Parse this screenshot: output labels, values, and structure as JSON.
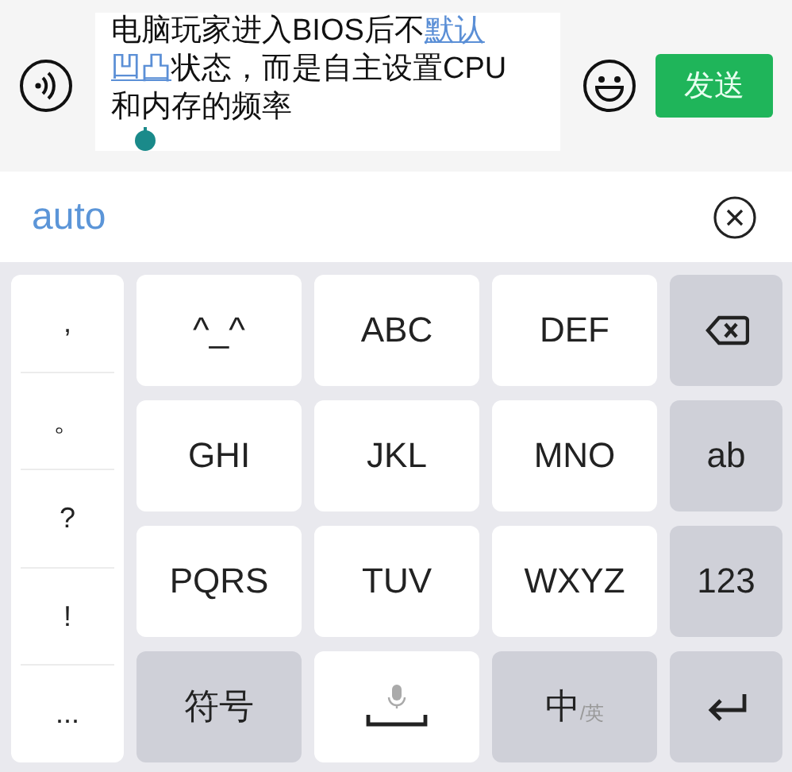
{
  "composer": {
    "message": [
      [
        {
          "text": "电脑玩家进入BIOS后不",
          "selected": false
        },
        {
          "text": "默认",
          "selected": true
        }
      ],
      [
        {
          "text": "凹凸",
          "selected": true
        },
        {
          "text": "状态，而是自主设置CPU",
          "selected": false
        }
      ],
      [
        {
          "text": "和内存的频率",
          "selected": false
        }
      ]
    ],
    "send_button": "发送"
  },
  "candidate_bar": {
    "candidate": "auto"
  },
  "keyboard": {
    "punctuation": [
      ",",
      "。",
      "?",
      "!",
      "..."
    ],
    "keys": [
      {
        "label": "^_^",
        "kind": "letter"
      },
      {
        "label": "ABC",
        "kind": "letter"
      },
      {
        "label": "DEF",
        "kind": "letter"
      },
      {
        "kind": "backspace"
      },
      {
        "label": "GHI",
        "kind": "letter"
      },
      {
        "label": "JKL",
        "kind": "letter"
      },
      {
        "label": "MNO",
        "kind": "letter"
      },
      {
        "label": "ab",
        "kind": "function"
      },
      {
        "label": "PQRS",
        "kind": "letter"
      },
      {
        "label": "TUV",
        "kind": "letter"
      },
      {
        "label": "WXYZ",
        "kind": "letter"
      },
      {
        "label": "123",
        "kind": "function"
      },
      {
        "label": "符号",
        "kind": "function"
      },
      {
        "kind": "space"
      },
      {
        "label": "中",
        "sublabel": "/英",
        "kind": "lang"
      },
      {
        "kind": "enter"
      }
    ]
  }
}
